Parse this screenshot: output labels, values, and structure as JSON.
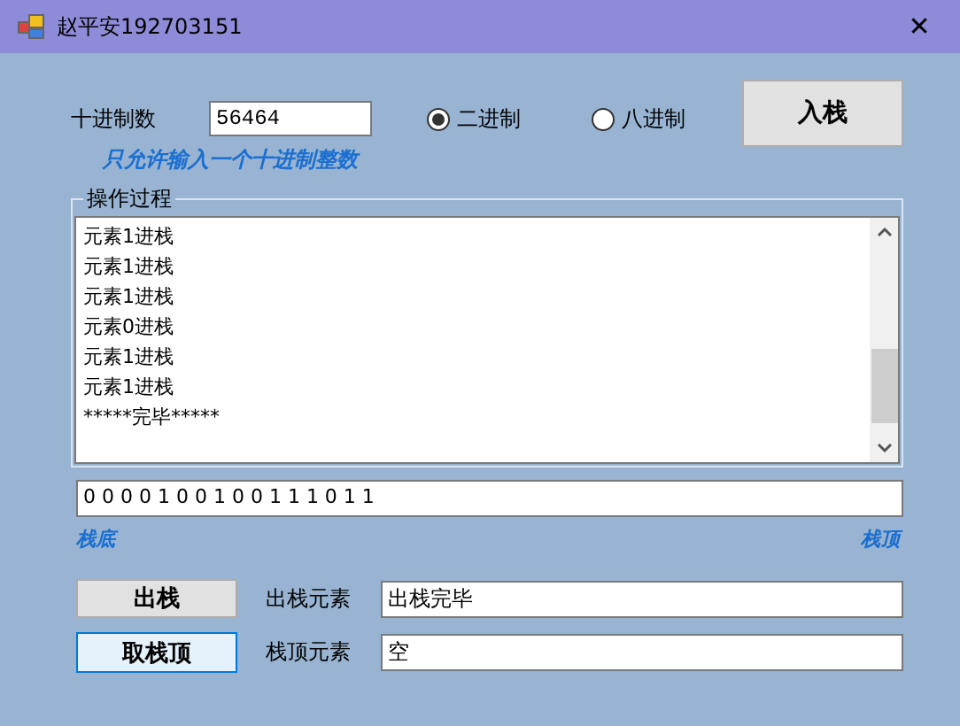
{
  "window": {
    "title": "赵平安192703151",
    "close": "✕"
  },
  "input": {
    "label": "十进制数",
    "value": "56464",
    "hint": "只允许输入一个十进制整数"
  },
  "radios": [
    {
      "label": "二进制",
      "selected": true
    },
    {
      "label": "八进制",
      "selected": false
    }
  ],
  "push_button": {
    "label": "入栈"
  },
  "log": {
    "title": "操作过程",
    "lines": [
      "元素1进栈",
      "元素1进栈",
      "元素1进栈",
      "元素0进栈",
      "元素1进栈",
      "元素1进栈",
      "*****完毕*****"
    ]
  },
  "stack": {
    "value": "0 0 0 0 1 0 0 1 0 0 1 1 1 0 1 1",
    "bottom_label": "栈底",
    "top_label": "栈顶"
  },
  "actions": [
    {
      "button": "出栈",
      "focused": false,
      "label": "出栈元素",
      "value": "出栈完毕"
    },
    {
      "button": "取栈顶",
      "focused": true,
      "label": "栈顶元素",
      "value": "空"
    }
  ]
}
